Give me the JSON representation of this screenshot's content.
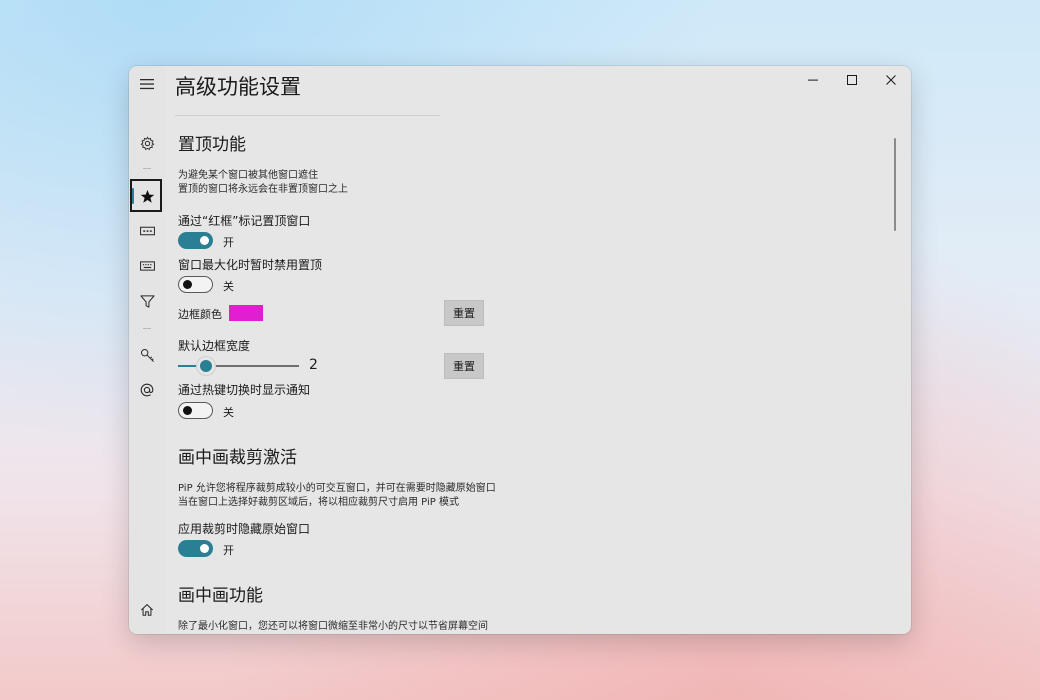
{
  "window": {
    "title": "高级功能设置",
    "caption_minimize": "–",
    "caption_maximize": "□",
    "caption_close": "✕"
  },
  "nav": {
    "icons": [
      "hamburger-icon",
      "gear-icon",
      "star-icon",
      "ellipsis-box-icon",
      "keyboard-icon",
      "filter-icon",
      "key-icon",
      "at-icon",
      "home-icon"
    ],
    "active": "star-icon"
  },
  "topmost": {
    "title": "置顶功能",
    "desc_line1": "为避免某个窗口被其他窗口遮住",
    "desc_line2": "置顶的窗口将永远会在非置顶窗口之上",
    "red_border_label": "通过“红框”标记置顶窗口",
    "red_border_state": "开",
    "red_border_on": true,
    "disable_max_label": "窗口最大化时暂时禁用置顶",
    "disable_max_state": "关",
    "disable_max_on": false,
    "border_color_label": "边框颜色",
    "border_color": "#e020d0",
    "reset_label_1": "重置",
    "border_width_label": "默认边框宽度",
    "border_width_value": "2",
    "reset_label_2": "重置",
    "hotkey_notify_label": "通过热键切换时显示通知",
    "hotkey_notify_state": "关",
    "hotkey_notify_on": false
  },
  "pip_crop": {
    "title": "画中画裁剪激活",
    "desc_line1": "PiP 允许您将程序裁剪成较小的可交互窗口，并可在需要时隐藏原始窗口",
    "desc_line2": "当在窗口上选择好裁剪区域后，将以相应裁剪尺寸启用 PiP 模式",
    "hide_original_label": "应用裁剪时隐藏原始窗口",
    "hide_original_state": "开",
    "hide_original_on": true
  },
  "pip": {
    "title": "画中画功能",
    "desc_line1": "除了最小化窗口，您还可以将窗口微缩至非常小的尺寸以节省屏幕空间"
  },
  "colors": {
    "accent": "#2b7f94",
    "window_bg": "#e6e6e6"
  }
}
